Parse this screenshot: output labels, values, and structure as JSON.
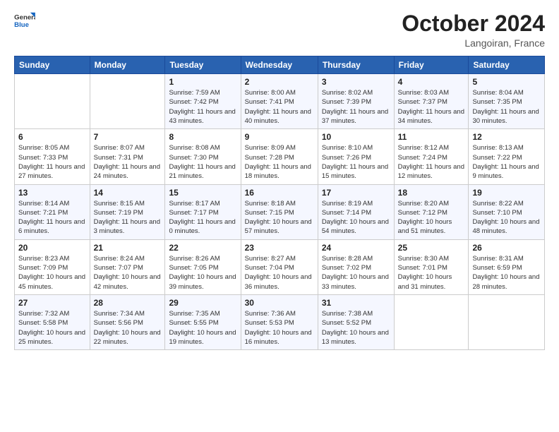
{
  "header": {
    "logo_general": "General",
    "logo_blue": "Blue",
    "month": "October 2024",
    "location": "Langoiran, France"
  },
  "weekdays": [
    "Sunday",
    "Monday",
    "Tuesday",
    "Wednesday",
    "Thursday",
    "Friday",
    "Saturday"
  ],
  "weeks": [
    [
      {
        "day": null
      },
      {
        "day": null
      },
      {
        "day": "1",
        "sunrise": "Sunrise: 7:59 AM",
        "sunset": "Sunset: 7:42 PM",
        "daylight": "Daylight: 11 hours and 43 minutes."
      },
      {
        "day": "2",
        "sunrise": "Sunrise: 8:00 AM",
        "sunset": "Sunset: 7:41 PM",
        "daylight": "Daylight: 11 hours and 40 minutes."
      },
      {
        "day": "3",
        "sunrise": "Sunrise: 8:02 AM",
        "sunset": "Sunset: 7:39 PM",
        "daylight": "Daylight: 11 hours and 37 minutes."
      },
      {
        "day": "4",
        "sunrise": "Sunrise: 8:03 AM",
        "sunset": "Sunset: 7:37 PM",
        "daylight": "Daylight: 11 hours and 34 minutes."
      },
      {
        "day": "5",
        "sunrise": "Sunrise: 8:04 AM",
        "sunset": "Sunset: 7:35 PM",
        "daylight": "Daylight: 11 hours and 30 minutes."
      }
    ],
    [
      {
        "day": "6",
        "sunrise": "Sunrise: 8:05 AM",
        "sunset": "Sunset: 7:33 PM",
        "daylight": "Daylight: 11 hours and 27 minutes."
      },
      {
        "day": "7",
        "sunrise": "Sunrise: 8:07 AM",
        "sunset": "Sunset: 7:31 PM",
        "daylight": "Daylight: 11 hours and 24 minutes."
      },
      {
        "day": "8",
        "sunrise": "Sunrise: 8:08 AM",
        "sunset": "Sunset: 7:30 PM",
        "daylight": "Daylight: 11 hours and 21 minutes."
      },
      {
        "day": "9",
        "sunrise": "Sunrise: 8:09 AM",
        "sunset": "Sunset: 7:28 PM",
        "daylight": "Daylight: 11 hours and 18 minutes."
      },
      {
        "day": "10",
        "sunrise": "Sunrise: 8:10 AM",
        "sunset": "Sunset: 7:26 PM",
        "daylight": "Daylight: 11 hours and 15 minutes."
      },
      {
        "day": "11",
        "sunrise": "Sunrise: 8:12 AM",
        "sunset": "Sunset: 7:24 PM",
        "daylight": "Daylight: 11 hours and 12 minutes."
      },
      {
        "day": "12",
        "sunrise": "Sunrise: 8:13 AM",
        "sunset": "Sunset: 7:22 PM",
        "daylight": "Daylight: 11 hours and 9 minutes."
      }
    ],
    [
      {
        "day": "13",
        "sunrise": "Sunrise: 8:14 AM",
        "sunset": "Sunset: 7:21 PM",
        "daylight": "Daylight: 11 hours and 6 minutes."
      },
      {
        "day": "14",
        "sunrise": "Sunrise: 8:15 AM",
        "sunset": "Sunset: 7:19 PM",
        "daylight": "Daylight: 11 hours and 3 minutes."
      },
      {
        "day": "15",
        "sunrise": "Sunrise: 8:17 AM",
        "sunset": "Sunset: 7:17 PM",
        "daylight": "Daylight: 11 hours and 0 minutes."
      },
      {
        "day": "16",
        "sunrise": "Sunrise: 8:18 AM",
        "sunset": "Sunset: 7:15 PM",
        "daylight": "Daylight: 10 hours and 57 minutes."
      },
      {
        "day": "17",
        "sunrise": "Sunrise: 8:19 AM",
        "sunset": "Sunset: 7:14 PM",
        "daylight": "Daylight: 10 hours and 54 minutes."
      },
      {
        "day": "18",
        "sunrise": "Sunrise: 8:20 AM",
        "sunset": "Sunset: 7:12 PM",
        "daylight": "Daylight: 10 hours and 51 minutes."
      },
      {
        "day": "19",
        "sunrise": "Sunrise: 8:22 AM",
        "sunset": "Sunset: 7:10 PM",
        "daylight": "Daylight: 10 hours and 48 minutes."
      }
    ],
    [
      {
        "day": "20",
        "sunrise": "Sunrise: 8:23 AM",
        "sunset": "Sunset: 7:09 PM",
        "daylight": "Daylight: 10 hours and 45 minutes."
      },
      {
        "day": "21",
        "sunrise": "Sunrise: 8:24 AM",
        "sunset": "Sunset: 7:07 PM",
        "daylight": "Daylight: 10 hours and 42 minutes."
      },
      {
        "day": "22",
        "sunrise": "Sunrise: 8:26 AM",
        "sunset": "Sunset: 7:05 PM",
        "daylight": "Daylight: 10 hours and 39 minutes."
      },
      {
        "day": "23",
        "sunrise": "Sunrise: 8:27 AM",
        "sunset": "Sunset: 7:04 PM",
        "daylight": "Daylight: 10 hours and 36 minutes."
      },
      {
        "day": "24",
        "sunrise": "Sunrise: 8:28 AM",
        "sunset": "Sunset: 7:02 PM",
        "daylight": "Daylight: 10 hours and 33 minutes."
      },
      {
        "day": "25",
        "sunrise": "Sunrise: 8:30 AM",
        "sunset": "Sunset: 7:01 PM",
        "daylight": "Daylight: 10 hours and 31 minutes."
      },
      {
        "day": "26",
        "sunrise": "Sunrise: 8:31 AM",
        "sunset": "Sunset: 6:59 PM",
        "daylight": "Daylight: 10 hours and 28 minutes."
      }
    ],
    [
      {
        "day": "27",
        "sunrise": "Sunrise: 7:32 AM",
        "sunset": "Sunset: 5:58 PM",
        "daylight": "Daylight: 10 hours and 25 minutes."
      },
      {
        "day": "28",
        "sunrise": "Sunrise: 7:34 AM",
        "sunset": "Sunset: 5:56 PM",
        "daylight": "Daylight: 10 hours and 22 minutes."
      },
      {
        "day": "29",
        "sunrise": "Sunrise: 7:35 AM",
        "sunset": "Sunset: 5:55 PM",
        "daylight": "Daylight: 10 hours and 19 minutes."
      },
      {
        "day": "30",
        "sunrise": "Sunrise: 7:36 AM",
        "sunset": "Sunset: 5:53 PM",
        "daylight": "Daylight: 10 hours and 16 minutes."
      },
      {
        "day": "31",
        "sunrise": "Sunrise: 7:38 AM",
        "sunset": "Sunset: 5:52 PM",
        "daylight": "Daylight: 10 hours and 13 minutes."
      },
      {
        "day": null
      },
      {
        "day": null
      }
    ]
  ]
}
